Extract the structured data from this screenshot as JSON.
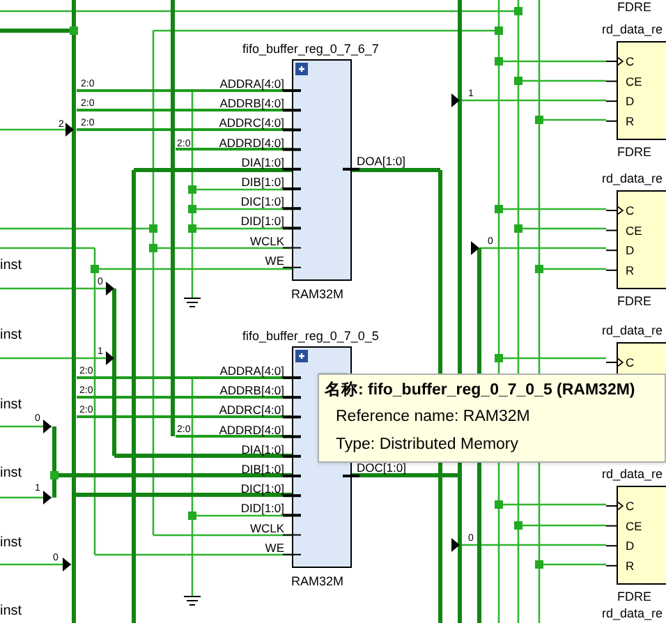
{
  "schematic": {
    "ram_cells": [
      {
        "name": "fifo_buffer_reg_0_7_6_7",
        "type": "RAM32M",
        "inputs": [
          "ADDRA[4:0]",
          "ADDRB[4:0]",
          "ADDRC[4:0]",
          "ADDRD[4:0]",
          "DIA[1:0]",
          "DIB[1:0]",
          "DIC[1:0]",
          "DID[1:0]",
          "WCLK",
          "WE"
        ],
        "output": "DOA[1:0]"
      },
      {
        "name": "fifo_buffer_reg_0_7_0_5",
        "type": "RAM32M",
        "inputs": [
          "ADDRA[4:0]",
          "ADDRB[4:0]",
          "ADDRC[4:0]",
          "ADDRD[4:0]",
          "DIA[1:0]",
          "DIB[1:0]",
          "DIC[1:0]",
          "DID[1:0]",
          "WCLK",
          "WE"
        ],
        "output": "DOC[1:0]"
      }
    ],
    "flip_flops": [
      {
        "type": "FDRE"
      },
      {
        "name": "rd_data_re",
        "type": "FDRE",
        "pins": [
          "C",
          "CE",
          "D",
          "R"
        ]
      },
      {
        "name": "rd_data_re",
        "type": "FDRE",
        "pins": [
          "C",
          "CE",
          "D",
          "R"
        ]
      },
      {
        "name": "rd_data_re",
        "pins": [
          "C"
        ]
      },
      {
        "name": "rd_data_re",
        "type": "FDRE",
        "pins": [
          "C",
          "CE",
          "D",
          "R"
        ]
      },
      {
        "name": "rd_data_re"
      }
    ],
    "port_labels": [
      "inst",
      "inst",
      "inst",
      "inst",
      "inst",
      "inst"
    ],
    "net_labels": [
      "2:0",
      "2:0",
      "2:0",
      "2",
      "2:0",
      "0",
      "1",
      "0",
      "1",
      "2:0",
      "2:0",
      "2:0",
      "2:0",
      "0",
      "1",
      "0",
      "0"
    ]
  },
  "tooltip": {
    "title": "名称: fifo_buffer_reg_0_7_0_5 (RAM32M)",
    "lines": [
      "Reference name: RAM32M",
      "Type: Distributed Memory"
    ]
  }
}
